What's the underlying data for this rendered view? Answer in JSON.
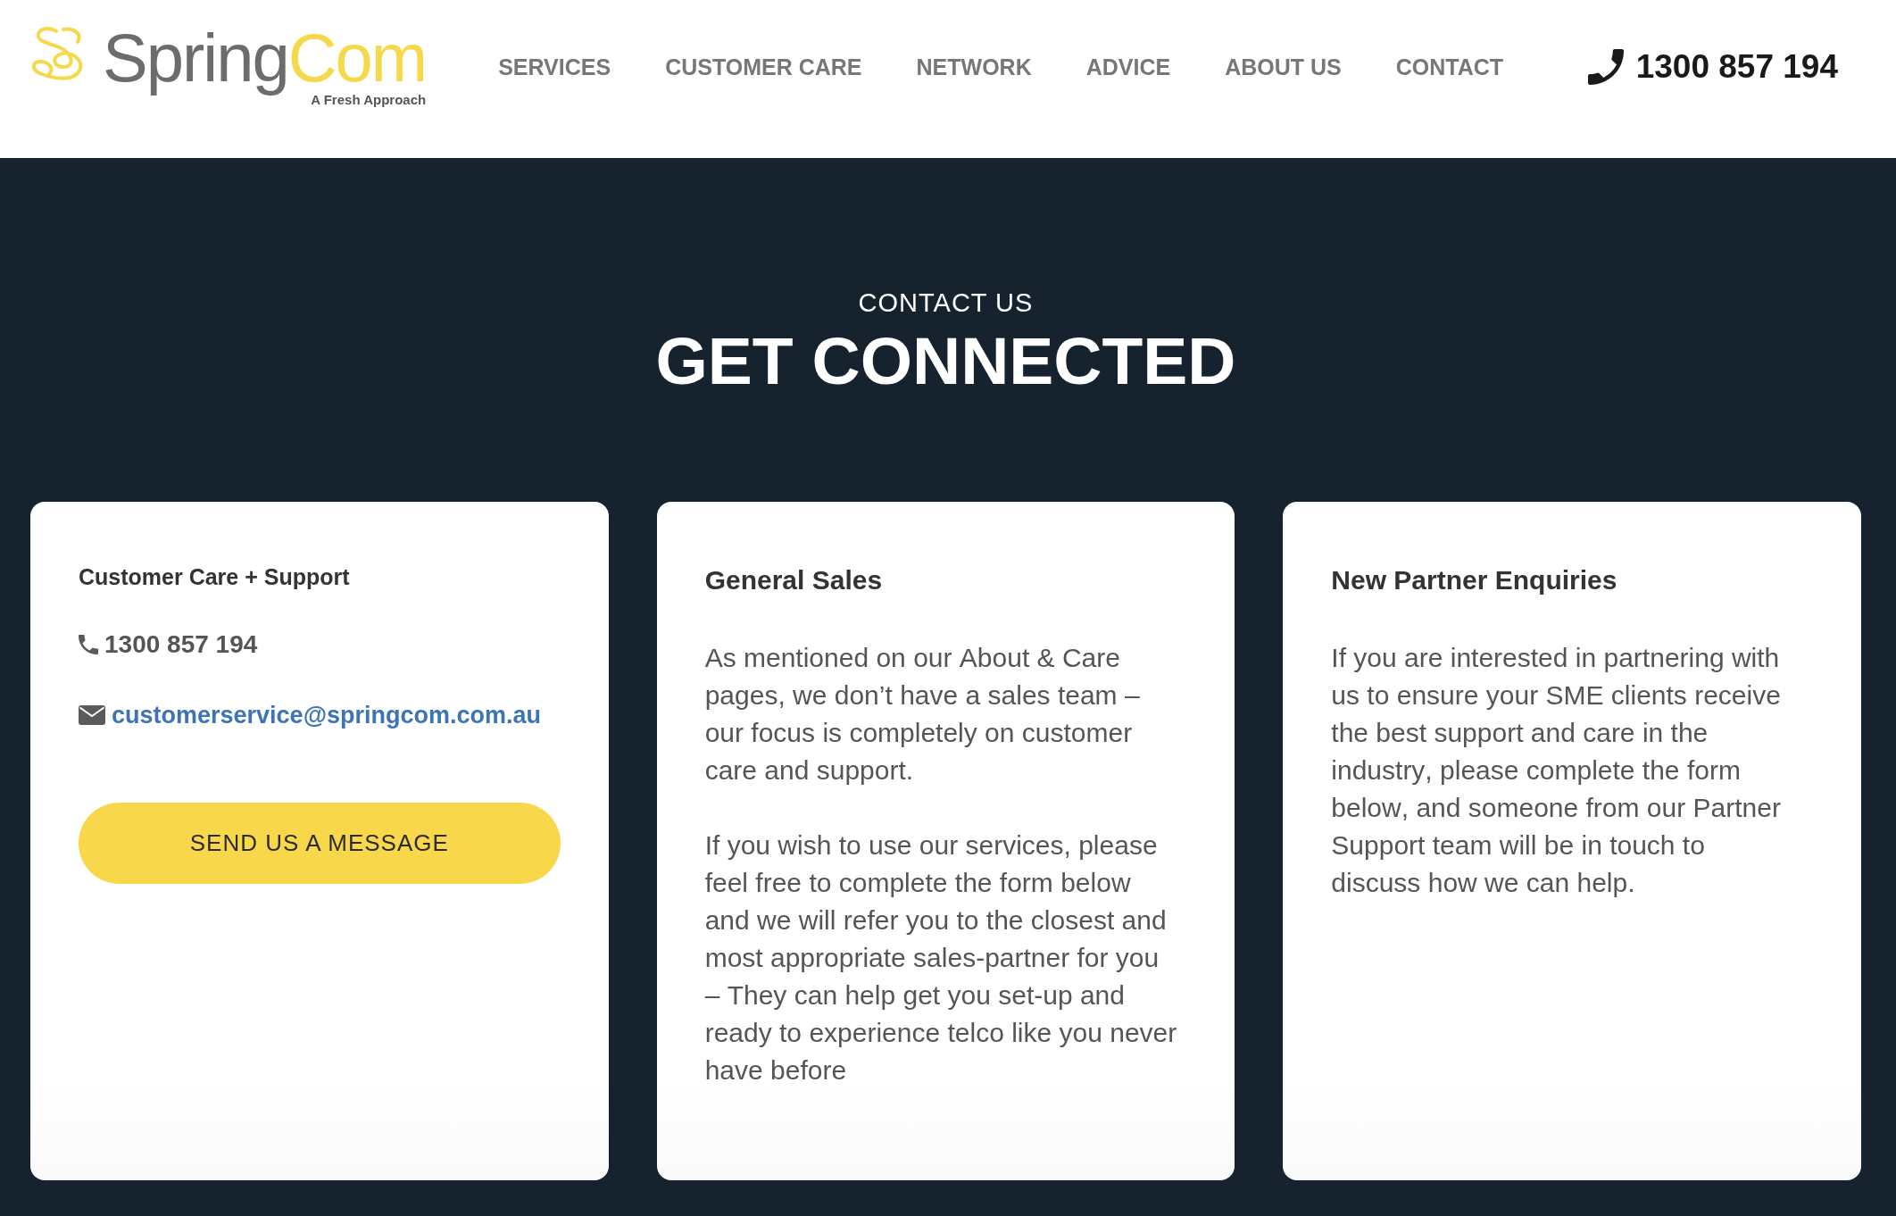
{
  "header": {
    "logo": {
      "name_part_1": "Spring",
      "name_part_2": "Com",
      "tagline": "A Fresh Approach"
    },
    "nav": [
      "SERVICES",
      "CUSTOMER CARE",
      "NETWORK",
      "ADVICE",
      "ABOUT US",
      "CONTACT"
    ],
    "phone": "1300 857 194"
  },
  "hero": {
    "eyebrow": "CONTACT US",
    "title": "GET CONNECTED"
  },
  "cards": [
    {
      "kind": "contact",
      "title": "Customer Care + Support",
      "phone": "1300 857 194",
      "email": "customerservice@springcom.com.au",
      "button": "SEND US A MESSAGE"
    },
    {
      "kind": "text",
      "title": "General Sales",
      "paragraphs": [
        "As mentioned on our About & Care pages, we don’t have a sales team – our focus is completely on customer care and support.",
        "If you wish to use our services, please feel free to complete the form below and we will refer you to the closest and most appropriate sales-partner for you – They can help get you set-up and ready to experience telco like you never have before"
      ]
    },
    {
      "kind": "text",
      "title": "New Partner Enquiries",
      "paragraphs": [
        "If you are interested in partnering with us to ensure your SME clients receive the best support and care in the industry, please complete the form below, and someone from our Partner Support team will be in touch to discuss how we can help."
      ]
    }
  ]
}
